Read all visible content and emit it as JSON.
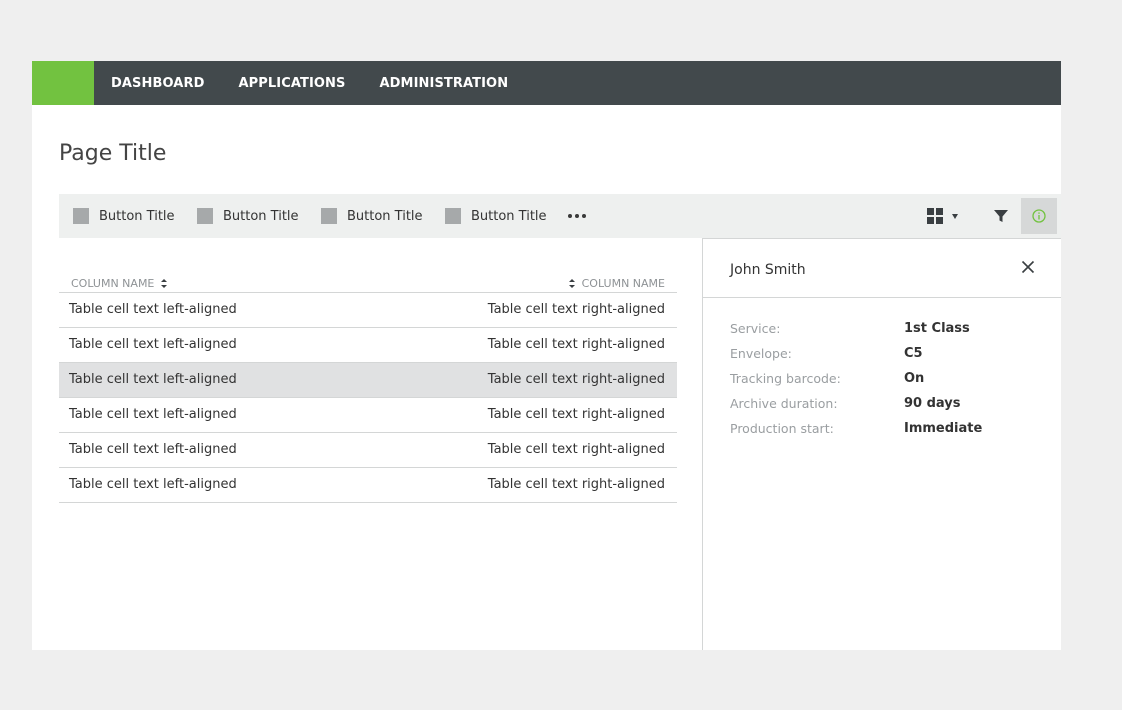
{
  "nav": {
    "items": [
      {
        "label": "DASHBOARD"
      },
      {
        "label": "APPLICATIONS"
      },
      {
        "label": "ADMINISTRATION"
      }
    ],
    "brand_color": "#72c240",
    "bar_color": "#42494c"
  },
  "page": {
    "title": "Page Title"
  },
  "toolbar": {
    "buttons": [
      {
        "label": "Button Title",
        "icon": "square-icon"
      },
      {
        "label": "Button Title",
        "icon": "square-icon"
      },
      {
        "label": "Button Title",
        "icon": "square-icon"
      },
      {
        "label": "Button Title",
        "icon": "square-icon"
      }
    ],
    "more_icon": "ellipsis-icon",
    "view_icon": "grid-view-icon",
    "filter_icon": "filter-icon",
    "info_icon": "info-icon",
    "active_accent": "#72c240"
  },
  "table": {
    "columns": [
      {
        "label": "COLUMN NAME"
      },
      {
        "label": "COLUMN NAME"
      }
    ],
    "rows": [
      {
        "left": "Table cell text left-aligned",
        "right": "Table cell text right-aligned",
        "selected": false
      },
      {
        "left": "Table cell text left-aligned",
        "right": "Table cell text right-aligned",
        "selected": false
      },
      {
        "left": "Table cell text left-aligned",
        "right": "Table cell text right-aligned",
        "selected": true
      },
      {
        "left": "Table cell text left-aligned",
        "right": "Table cell text right-aligned",
        "selected": false
      },
      {
        "left": "Table cell text left-aligned",
        "right": "Table cell text right-aligned",
        "selected": false
      },
      {
        "left": "Table cell text left-aligned",
        "right": "Table cell text right-aligned",
        "selected": false
      }
    ]
  },
  "details": {
    "title": "John Smith",
    "close_icon": "close-icon",
    "properties": [
      {
        "label": "Service:",
        "value": "1st Class"
      },
      {
        "label": "Envelope:",
        "value": "C5"
      },
      {
        "label": "Tracking barcode:",
        "value": "On"
      },
      {
        "label": "Archive duration:",
        "value": "90 days"
      },
      {
        "label": "Production start:",
        "value": "Immediate"
      }
    ]
  }
}
